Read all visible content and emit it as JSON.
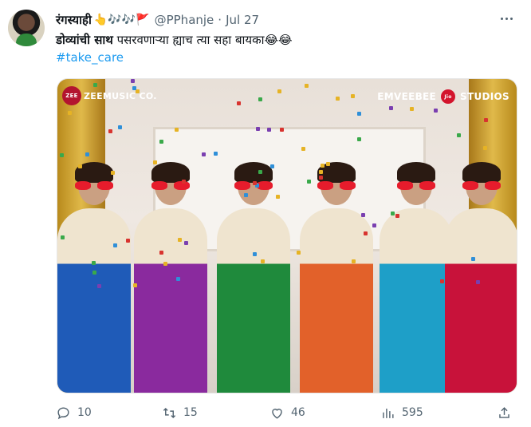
{
  "tweet": {
    "display_name": "रंगस्याही",
    "name_emojis": "👆🎶🎶🚩",
    "handle": "@PPhanje",
    "separator": "·",
    "date": "Jul 27",
    "text_bold": "डोव्यांची साथ",
    "text_rest": " पसरवणाऱ्या ह्याच त्या सहा बायका😂😂",
    "hashtag": "#take_care"
  },
  "media": {
    "logo_left": "ZEEMUSIC CO.",
    "logo_right": "EMVEEBEE",
    "logo_right_studios": "STUDIOS",
    "saree_colors": [
      "#1f5bb8",
      "#8a2a9e",
      "#1f8a3c",
      "#e2612a",
      "#1e9fc8",
      "#c8123a"
    ]
  },
  "actions": {
    "replies": "10",
    "retweets": "15",
    "likes": "46",
    "views": "595"
  },
  "icons": {
    "reply": "reply-icon",
    "retweet": "retweet-icon",
    "like": "heart-icon",
    "views": "views-icon",
    "share": "share-icon",
    "more": "more-icon"
  },
  "colors": {
    "link": "#1d9bf0",
    "secondary_text": "#536471"
  }
}
